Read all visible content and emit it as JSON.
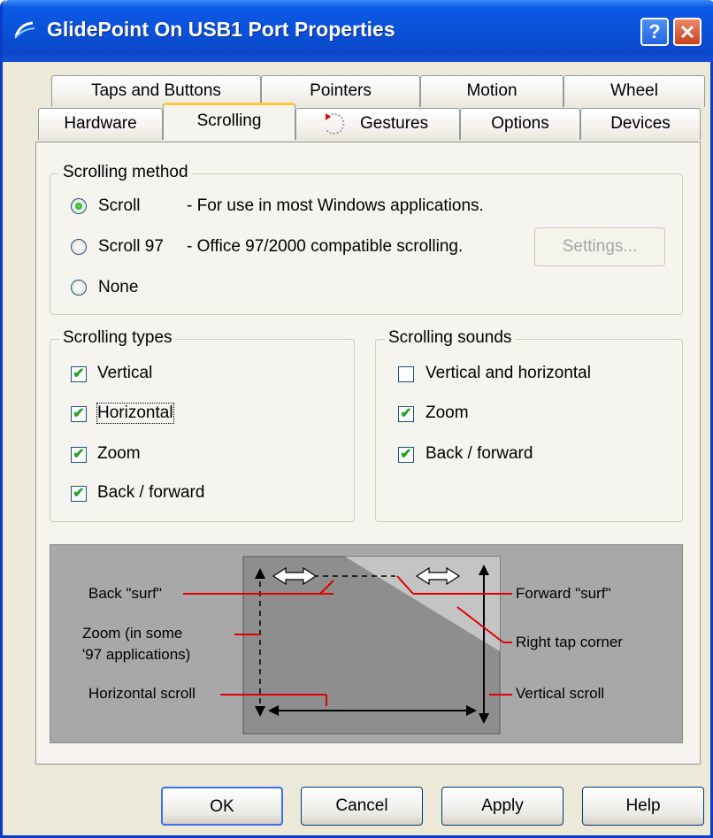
{
  "window": {
    "title": "GlidePoint On USB1 Port Properties",
    "help_glyph": "?",
    "close_glyph": "✕"
  },
  "tabs_row1": [
    "Taps and Buttons",
    "Pointers",
    "Motion",
    "Wheel"
  ],
  "tabs_row2": [
    "Hardware",
    "Scrolling",
    "Gestures",
    "Options",
    "Devices"
  ],
  "active_tab": "Scrolling",
  "scrolling_method": {
    "legend": "Scrolling method",
    "options": [
      {
        "label": "Scroll",
        "description": "- For use in most Windows applications.",
        "checked": true
      },
      {
        "label": "Scroll 97",
        "description": "- Office 97/2000 compatible scrolling.",
        "checked": false
      },
      {
        "label": "None",
        "description": "",
        "checked": false
      }
    ],
    "settings_button": "Settings..."
  },
  "scrolling_types": {
    "legend": "Scrolling types",
    "items": [
      {
        "label": "Vertical",
        "checked": true
      },
      {
        "label": "Horizontal",
        "checked": true
      },
      {
        "label": "Zoom",
        "checked": true
      },
      {
        "label": "Back / forward",
        "checked": true
      }
    ]
  },
  "scrolling_sounds": {
    "legend": "Scrolling sounds",
    "items": [
      {
        "label": "Vertical and horizontal",
        "checked": false
      },
      {
        "label": "Zoom",
        "checked": true
      },
      {
        "label": "Back / forward",
        "checked": true
      }
    ]
  },
  "diagram": {
    "back_surf": "Back \"surf\"",
    "zoom_line1": "Zoom (in some",
    "zoom_line2": "'97 applications)",
    "horizontal_scroll": "Horizontal scroll",
    "forward_surf": "Forward \"surf\"",
    "right_tap_corner": "Right tap corner",
    "vertical_scroll": "Vertical scroll"
  },
  "buttons": {
    "ok": "OK",
    "cancel": "Cancel",
    "apply": "Apply",
    "help": "Help"
  },
  "colors": {
    "titlebar": "#0a4fd6",
    "dialog_bg": "#ece9d8",
    "tab_highlight": "#ffc83c",
    "diagram_bg": "#a8a8a8",
    "annotation_line": "#e00000"
  }
}
